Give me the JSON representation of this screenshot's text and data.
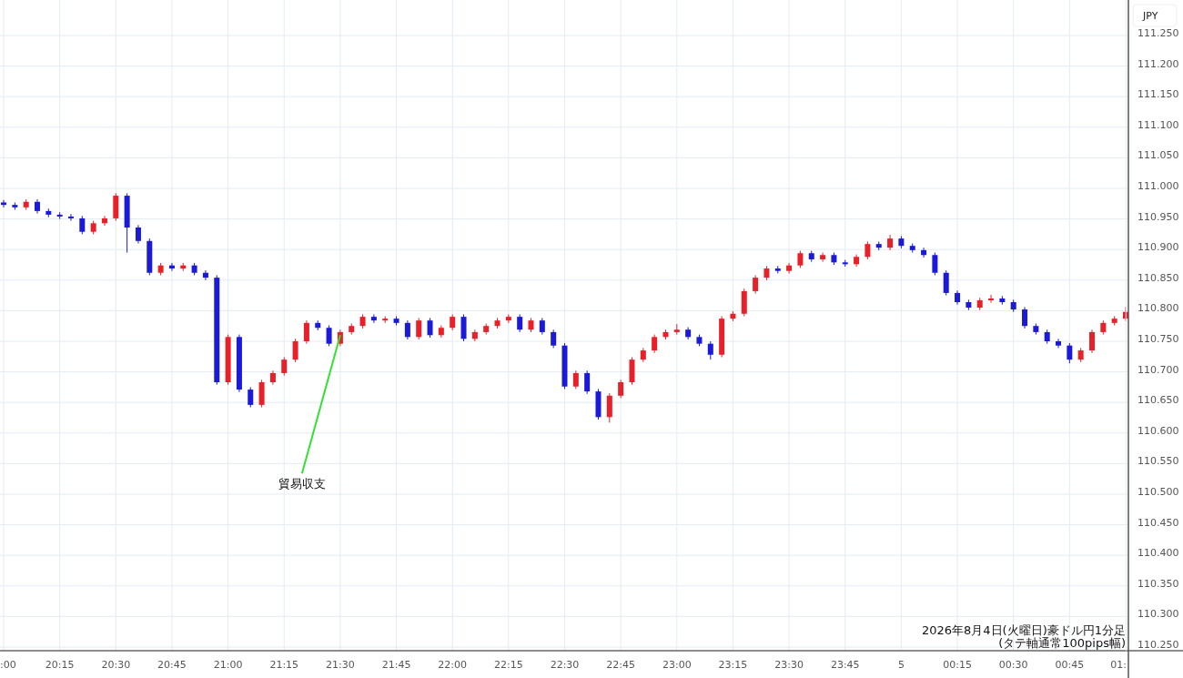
{
  "chart": {
    "currency_label": "JPY",
    "edge_time_label": "01:",
    "caption_lines": [
      "2026年8月4日(火曜日)豪ドル円1分足",
      "(タテ軸通常100pips幅)"
    ],
    "chart_data": {
      "type": "candlestick",
      "grid": true,
      "ylim": [
        110.25,
        111.25
      ],
      "categories": [
        ":00",
        null,
        null,
        null,
        null,
        "20:15",
        null,
        null,
        null,
        null,
        "20:30",
        null,
        null,
        null,
        null,
        "20:45",
        null,
        null,
        null,
        null,
        "21:00",
        null,
        null,
        null,
        null,
        "21:15",
        null,
        null,
        null,
        null,
        "21:30",
        null,
        null,
        null,
        null,
        "21:45",
        null,
        null,
        null,
        null,
        "22:00",
        null,
        null,
        null,
        null,
        "22:15",
        null,
        null,
        null,
        null,
        "22:30",
        null,
        null,
        null,
        null,
        "22:45",
        null,
        null,
        null,
        null,
        "23:00",
        null,
        null,
        null,
        null,
        "23:15",
        null,
        null,
        null,
        null,
        "23:30",
        null,
        null,
        null,
        null,
        "23:45",
        null,
        null,
        null,
        null,
        "5",
        null,
        null,
        null,
        null,
        "00:15",
        null,
        null,
        null,
        null,
        "00:30",
        null,
        null,
        null,
        null,
        "00:45",
        null,
        null,
        null,
        null,
        null
      ],
      "yticks": [
        {
          "value": 111.25,
          "label": "111.250"
        },
        {
          "value": 111.2,
          "label": "111.200"
        },
        {
          "value": 111.15,
          "label": "111.150"
        },
        {
          "value": 111.1,
          "label": "111.100"
        },
        {
          "value": 111.05,
          "label": "111.050"
        },
        {
          "value": 111.0,
          "label": "111.000"
        },
        {
          "value": 110.95,
          "label": "110.950"
        },
        {
          "value": 110.9,
          "label": "110.900"
        },
        {
          "value": 110.85,
          "label": "110.850"
        },
        {
          "value": 110.8,
          "label": "110.800"
        },
        {
          "value": 110.75,
          "label": "110.750"
        },
        {
          "value": 110.7,
          "label": "110.700"
        },
        {
          "value": 110.65,
          "label": "110.650"
        },
        {
          "value": 110.6,
          "label": "110.600"
        },
        {
          "value": 110.55,
          "label": "110.550"
        },
        {
          "value": 110.5,
          "label": "110.500"
        },
        {
          "value": 110.45,
          "label": "110.450"
        },
        {
          "value": 110.4,
          "label": "110.400"
        },
        {
          "value": 110.35,
          "label": "110.350"
        },
        {
          "value": 110.3,
          "label": "110.300"
        },
        {
          "value": 110.25,
          "label": "110.250"
        }
      ],
      "ohlc": [
        [
          110.977,
          110.981,
          110.969,
          110.973
        ],
        [
          110.973,
          110.977,
          110.965,
          110.969
        ],
        [
          110.969,
          110.982,
          110.965,
          110.978
        ],
        [
          110.978,
          110.982,
          110.959,
          110.963
        ],
        [
          110.963,
          110.967,
          110.953,
          110.957
        ],
        [
          110.957,
          110.961,
          110.95,
          110.954
        ],
        [
          110.954,
          110.958,
          110.947,
          110.951
        ],
        [
          110.951,
          110.955,
          110.925,
          110.929
        ],
        [
          110.929,
          110.947,
          110.925,
          110.943
        ],
        [
          110.943,
          110.955,
          110.939,
          110.951
        ],
        [
          110.951,
          110.992,
          110.947,
          110.988
        ],
        [
          110.988,
          110.992,
          110.895,
          110.936
        ],
        [
          110.936,
          110.94,
          110.91,
          110.914
        ],
        [
          110.914,
          110.918,
          110.858,
          110.862
        ],
        [
          110.862,
          110.878,
          110.858,
          110.874
        ],
        [
          110.874,
          110.878,
          110.865,
          110.869
        ],
        [
          110.869,
          110.878,
          110.865,
          110.874
        ],
        [
          110.874,
          110.878,
          110.858,
          110.862
        ],
        [
          110.862,
          110.866,
          110.85,
          110.854
        ],
        [
          110.854,
          110.858,
          110.679,
          110.683
        ],
        [
          110.683,
          110.761,
          110.679,
          110.757
        ],
        [
          110.757,
          110.761,
          110.667,
          110.671
        ],
        [
          110.671,
          110.675,
          110.642,
          110.646
        ],
        [
          110.646,
          110.687,
          110.642,
          110.683
        ],
        [
          110.683,
          110.702,
          110.679,
          110.698
        ],
        [
          110.698,
          110.724,
          110.694,
          110.72
        ],
        [
          110.72,
          110.754,
          110.716,
          110.75
        ],
        [
          110.75,
          110.784,
          110.746,
          110.78
        ],
        [
          110.78,
          110.784,
          110.768,
          110.772
        ],
        [
          110.772,
          110.776,
          110.742,
          110.746
        ],
        [
          110.746,
          110.769,
          110.742,
          110.765
        ],
        [
          110.765,
          110.779,
          110.761,
          110.775
        ],
        [
          110.775,
          110.794,
          110.771,
          110.79
        ],
        [
          110.79,
          110.794,
          110.78,
          110.784
        ],
        [
          110.784,
          110.791,
          110.78,
          110.787
        ],
        [
          110.787,
          110.791,
          110.776,
          110.78
        ],
        [
          110.78,
          110.784,
          110.753,
          110.757
        ],
        [
          110.757,
          110.788,
          110.753,
          110.784
        ],
        [
          110.784,
          110.788,
          110.756,
          110.76
        ],
        [
          110.76,
          110.776,
          110.756,
          110.772
        ],
        [
          110.772,
          110.794,
          110.768,
          110.79
        ],
        [
          110.79,
          110.794,
          110.75,
          110.754
        ],
        [
          110.754,
          110.769,
          110.75,
          110.765
        ],
        [
          110.765,
          110.779,
          110.761,
          110.775
        ],
        [
          110.775,
          110.788,
          110.771,
          110.784
        ],
        [
          110.784,
          110.794,
          110.78,
          110.79
        ],
        [
          110.79,
          110.794,
          110.765,
          110.769
        ],
        [
          110.769,
          110.788,
          110.765,
          110.784
        ],
        [
          110.784,
          110.788,
          110.761,
          110.765
        ],
        [
          110.765,
          110.769,
          110.739,
          110.743
        ],
        [
          110.743,
          110.747,
          110.672,
          110.676
        ],
        [
          110.676,
          110.702,
          110.672,
          110.698
        ],
        [
          110.698,
          110.702,
          110.664,
          110.668
        ],
        [
          110.668,
          110.672,
          110.622,
          110.626
        ],
        [
          110.626,
          110.665,
          110.617,
          110.661
        ],
        [
          110.661,
          110.687,
          110.657,
          110.683
        ],
        [
          110.683,
          110.724,
          110.679,
          110.72
        ],
        [
          110.72,
          110.739,
          110.716,
          110.735
        ],
        [
          110.735,
          110.761,
          110.731,
          110.757
        ],
        [
          110.757,
          110.769,
          110.753,
          110.765
        ],
        [
          110.765,
          110.778,
          110.761,
          110.769
        ],
        [
          110.769,
          110.773,
          110.753,
          110.757
        ],
        [
          110.757,
          110.761,
          110.742,
          110.746
        ],
        [
          110.746,
          110.75,
          110.72,
          110.728
        ],
        [
          110.728,
          110.791,
          110.724,
          110.787
        ],
        [
          110.787,
          110.799,
          110.783,
          110.795
        ],
        [
          110.795,
          110.836,
          110.791,
          110.832
        ],
        [
          110.832,
          110.858,
          110.828,
          110.854
        ],
        [
          110.854,
          110.873,
          110.85,
          110.869
        ],
        [
          110.869,
          110.873,
          110.861,
          110.865
        ],
        [
          110.865,
          110.878,
          110.861,
          110.874
        ],
        [
          110.874,
          110.898,
          110.87,
          110.894
        ],
        [
          110.894,
          110.898,
          110.88,
          110.884
        ],
        [
          110.884,
          110.895,
          110.88,
          110.891
        ],
        [
          110.891,
          110.895,
          110.875,
          110.879
        ],
        [
          110.879,
          110.883,
          110.872,
          110.876
        ],
        [
          110.876,
          110.892,
          110.872,
          110.888
        ],
        [
          110.888,
          110.913,
          110.884,
          110.909
        ],
        [
          110.909,
          110.913,
          110.899,
          110.903
        ],
        [
          110.903,
          110.924,
          110.899,
          110.918
        ],
        [
          110.918,
          110.922,
          110.902,
          110.906
        ],
        [
          110.906,
          110.91,
          110.895,
          110.899
        ],
        [
          110.899,
          110.903,
          110.887,
          110.891
        ],
        [
          110.891,
          110.895,
          110.858,
          110.862
        ],
        [
          110.862,
          110.866,
          110.825,
          110.829
        ],
        [
          110.829,
          110.833,
          110.81,
          110.814
        ],
        [
          110.814,
          110.818,
          110.801,
          110.805
        ],
        [
          110.805,
          110.821,
          110.801,
          110.817
        ],
        [
          110.817,
          110.826,
          110.813,
          110.82
        ],
        [
          110.82,
          110.824,
          110.81,
          110.814
        ],
        [
          110.814,
          110.818,
          110.798,
          110.802
        ],
        [
          110.802,
          110.806,
          110.771,
          110.775
        ],
        [
          110.775,
          110.779,
          110.761,
          110.765
        ],
        [
          110.765,
          110.769,
          110.746,
          110.75
        ],
        [
          110.75,
          110.754,
          110.739,
          110.743
        ],
        [
          110.743,
          110.747,
          110.714,
          110.72
        ],
        [
          110.72,
          110.739,
          110.716,
          110.735
        ],
        [
          110.735,
          110.769,
          110.731,
          110.765
        ],
        [
          110.765,
          110.784,
          110.761,
          110.78
        ],
        [
          110.78,
          110.791,
          110.776,
          110.787
        ],
        [
          110.787,
          110.806,
          110.783,
          110.798
        ]
      ],
      "annotations": [
        {
          "text": "貿易収支",
          "x": "21:30",
          "y": 110.76
        }
      ]
    }
  }
}
